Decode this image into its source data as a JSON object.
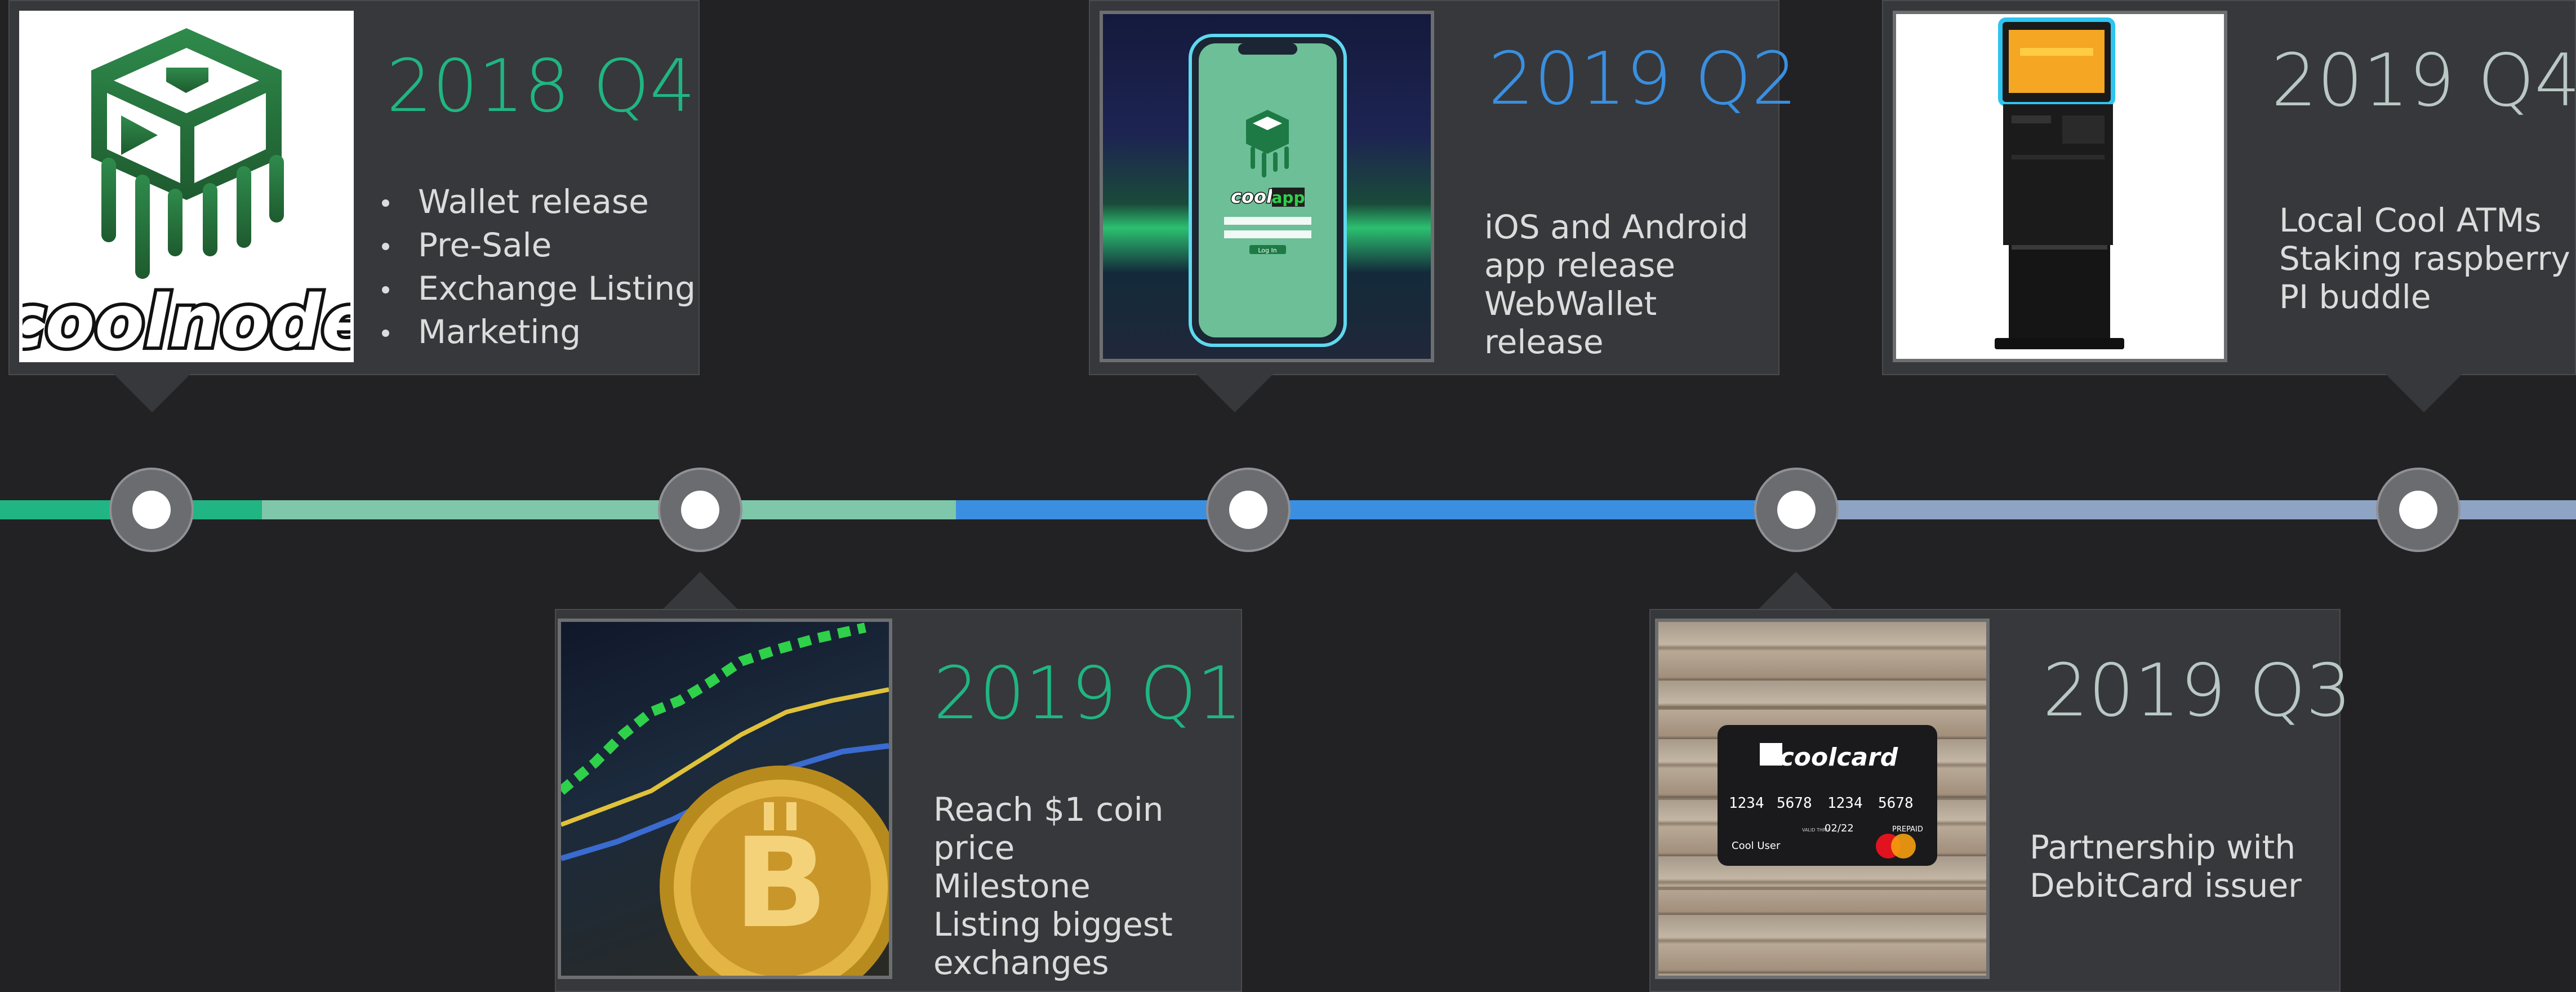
{
  "colors": {
    "background": "#222225",
    "card": "#37383b",
    "green": "#20b582",
    "light_green": "#7ec7aa",
    "blue": "#3a8fe0",
    "grey_blue": "#8ea4c4",
    "grey": "#b9c8c4"
  },
  "milestones": [
    {
      "title": "2018 Q4",
      "items": [
        "Wallet release",
        "Pre-Sale",
        "Exchange Listing",
        "Marketing"
      ],
      "image": "coolnode-logo"
    },
    {
      "title": "2019 Q1",
      "lines": [
        "Reach $1 coin price",
        "Milestone",
        "Listing biggest",
        "exchanges"
      ],
      "image": "bitcoin-coin-photo"
    },
    {
      "title": "2019 Q2",
      "lines": [
        "iOS and Android",
        "app release",
        "WebWallet release"
      ],
      "image": "coolapp-phone"
    },
    {
      "title": "2019 Q3",
      "lines": [
        "Partnership with",
        "DebitCard issuer"
      ],
      "image": "coolcard-debit-card"
    },
    {
      "title": "2019 Q4",
      "lines": [
        "Local Cool ATMs",
        "Staking raspberry",
        "PI buddle"
      ],
      "image": "atm-kiosk"
    }
  ],
  "logo": {
    "wordmark": "coolnode"
  },
  "coolapp": {
    "wordmark": "cool",
    "badge": "app",
    "button": "Log In"
  },
  "coolcard": {
    "wordmark": "coolcard",
    "number": [
      "1234",
      "5678",
      "1234",
      "5678"
    ],
    "valid_label": "VALID THRU",
    "expiry": "02/22",
    "holder": "Cool User",
    "type": "PREPAID"
  }
}
